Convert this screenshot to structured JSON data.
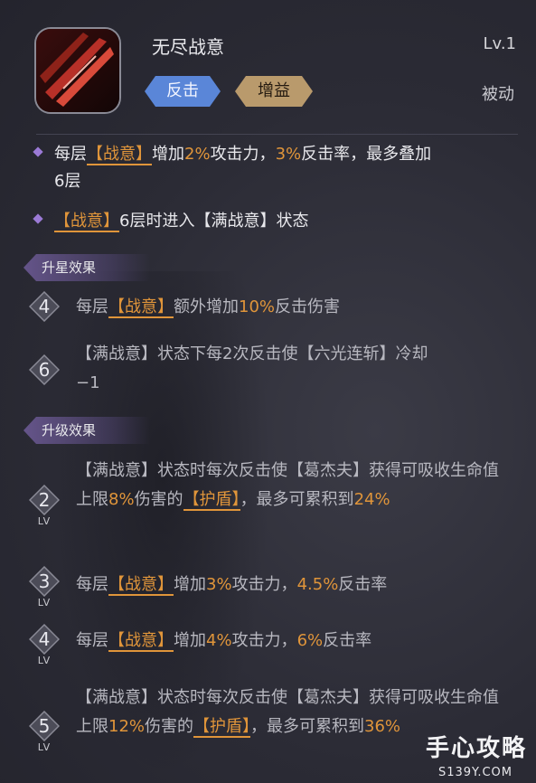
{
  "skill": {
    "name": "无尽战意",
    "level": "Lv.1",
    "tags": [
      "反击",
      "增益"
    ],
    "type": "被动"
  },
  "effects": [
    {
      "parts": [
        "每层",
        "【战意】",
        "增加",
        "2%",
        "攻击力，",
        "3%",
        "反击率，最多叠加",
        "6层"
      ]
    },
    {
      "parts": [
        "【战意】",
        "6层时进入【满战意】状态"
      ]
    }
  ],
  "star_section": {
    "label": "升星效果",
    "items": [
      {
        "badge": "4",
        "parts": [
          "每层",
          "【战意】",
          "额外增加",
          "10%",
          "反击伤害"
        ]
      },
      {
        "badge": "6",
        "parts": [
          "【满战意】状态下每2次反击使【六光连斩】冷却",
          "−1"
        ]
      }
    ]
  },
  "upgrade_section": {
    "label": "升级效果",
    "lv_label": "LV",
    "items": [
      {
        "badge": "2",
        "parts": [
          "【满战意】状态时每次反击使【葛杰夫】获得可吸收生命值上限",
          "8%",
          "伤害的",
          "【护盾】",
          "，最多可累积到",
          "24%"
        ]
      },
      {
        "badge": "3",
        "parts": [
          "每层",
          "【战意】",
          "增加",
          "3%",
          "攻击力，",
          "4.5%",
          "反击率"
        ]
      },
      {
        "badge": "4",
        "parts": [
          "每层",
          "【战意】",
          "增加",
          "4%",
          "攻击力，",
          "6%",
          "反击率"
        ]
      },
      {
        "badge": "5",
        "parts": [
          "【满战意】状态时每次反击使【葛杰夫】获得可吸收生命值上限",
          "12%",
          "伤害的",
          "【护盾】",
          "，最多可累积到",
          "36%"
        ]
      }
    ]
  },
  "watermark": {
    "text": "手心攻略",
    "url": "S139Y.COM"
  },
  "colors": {
    "accent_orange": "#e0953a",
    "tag_counter": "#5a86d8",
    "tag_buff": "#b99a6c",
    "section_purple": "#9b7ad6"
  }
}
